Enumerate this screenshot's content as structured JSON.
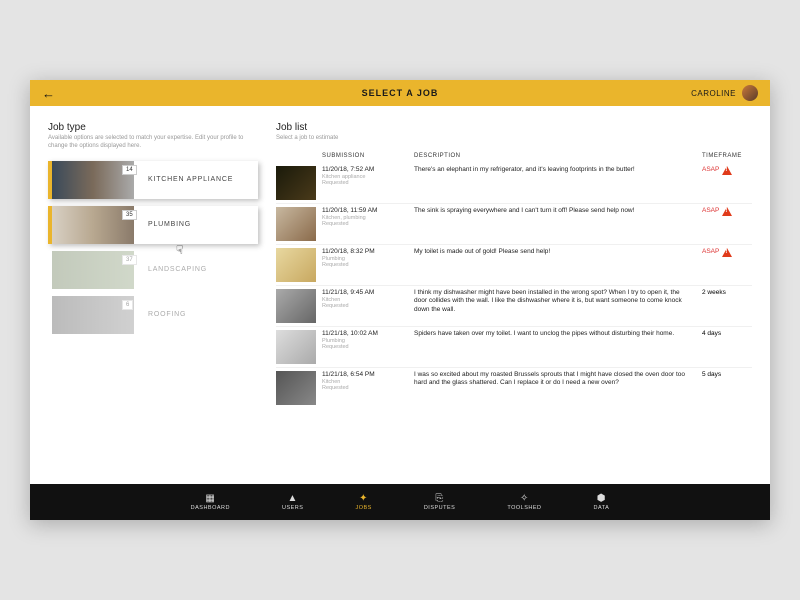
{
  "header": {
    "title": "SELECT A JOB",
    "user": "CAROLINE"
  },
  "jobtype": {
    "heading": "Job type",
    "sub": "Available options are selected to match your expertise. Edit your profile to change the options displayed here.",
    "items": [
      {
        "label": "KITCHEN APPLIANCE",
        "count": "14",
        "selected": true
      },
      {
        "label": "PLUMBING",
        "count": "35",
        "selected": true
      },
      {
        "label": "LANDSCAPING",
        "count": "37",
        "selected": false
      },
      {
        "label": "ROOFING",
        "count": "6",
        "selected": false
      }
    ]
  },
  "joblist": {
    "heading": "Job list",
    "sub": "Select a job to estimate",
    "cols": {
      "submission": "SUBMISSION",
      "description": "DESCRIPTION",
      "timeframe": "TIMEFRAME"
    },
    "rows": [
      {
        "date": "11/20/18, 7:52 AM",
        "cat": "Kitchen appliance",
        "status": "Requested",
        "desc": "There's an elephant in my refrigerator, and it's leaving footprints in the butter!",
        "tf": "ASAP",
        "urgent": true
      },
      {
        "date": "11/20/18, 11:59 AM",
        "cat": "Kitchen, plumbing",
        "status": "Requested",
        "desc": "The sink is spraying everywhere and I can't turn it off! Please send help now!",
        "tf": "ASAP",
        "urgent": true
      },
      {
        "date": "11/20/18, 8:32 PM",
        "cat": "Plumbing",
        "status": "Requested",
        "desc": "My toilet is made out of gold! Please send help!",
        "tf": "ASAP",
        "urgent": true
      },
      {
        "date": "11/21/18, 9:45 AM",
        "cat": "Kitchen",
        "status": "Requested",
        "desc": "I think my dishwasher might have been installed in the wrong spot? When I try to open it, the door collides with the wall. I like the dishwasher where it is, but want someone to come knock down the wall.",
        "tf": "2 weeks",
        "urgent": false
      },
      {
        "date": "11/21/18, 10:02 AM",
        "cat": "Plumbing",
        "status": "Requested",
        "desc": "Spiders have taken over my toilet. I want to unclog the pipes without disturbing their home.",
        "tf": "4 days",
        "urgent": false
      },
      {
        "date": "11/21/18, 6:54 PM",
        "cat": "Kitchen",
        "status": "Requested",
        "desc": "I was so excited about my roasted Brussels sprouts that I might have closed the oven door too hard and the glass shattered. Can I replace it or do I need a new oven?",
        "tf": "5 days",
        "urgent": false
      }
    ]
  },
  "nav": {
    "items": [
      {
        "label": "DASHBOARD",
        "icon": "▦"
      },
      {
        "label": "USERS",
        "icon": "▲"
      },
      {
        "label": "JOBS",
        "icon": "✦",
        "active": true
      },
      {
        "label": "DISPUTES",
        "icon": "⎘"
      },
      {
        "label": "TOOLSHED",
        "icon": "✧"
      },
      {
        "label": "DATA",
        "icon": "⬢"
      }
    ]
  }
}
